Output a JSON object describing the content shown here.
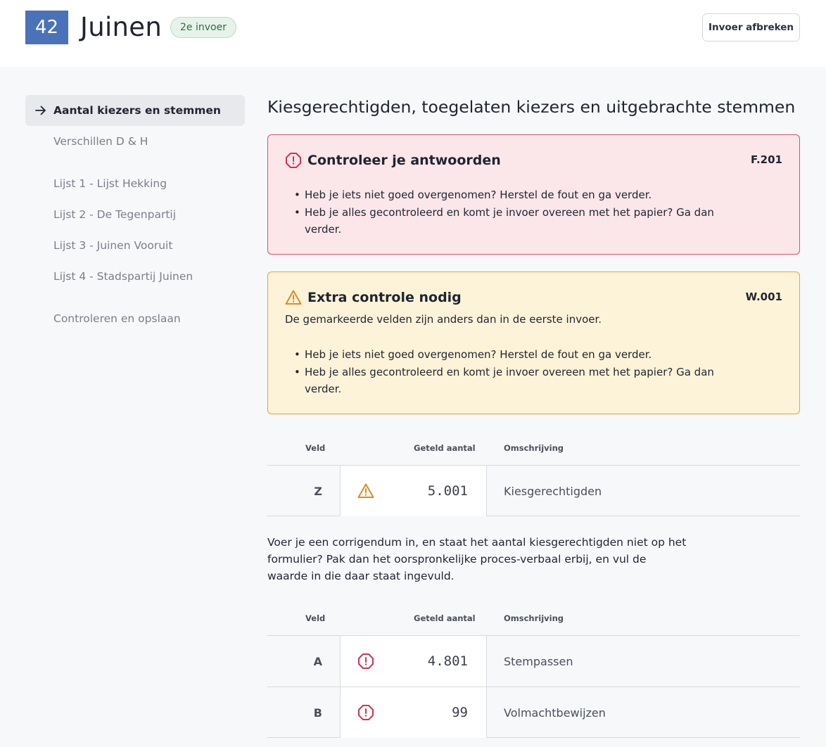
{
  "header": {
    "number": "42",
    "municipality": "Juinen",
    "entry_badge": "2e invoer",
    "abort_label": "Invoer afbreken"
  },
  "sidebar": {
    "items": [
      {
        "label": "Aantal kiezers en stemmen",
        "active": true
      },
      {
        "label": "Verschillen D & H"
      },
      {
        "label": "Lijst 1 - Lijst Hekking"
      },
      {
        "label": "Lijst 2 - De Tegenpartij"
      },
      {
        "label": "Lijst 3 - Juinen Vooruit"
      },
      {
        "label": "Lijst 4 - Stadspartij Juinen"
      },
      {
        "label": "Controleren en opslaan"
      }
    ]
  },
  "main": {
    "title": "Kiesgerechtigden, toegelaten kiezers en uitgebrachte stemmen",
    "error_alert": {
      "icon": "error-octagon-icon",
      "title": "Controleer je antwoorden",
      "code": "F.201",
      "items": [
        "Heb je iets niet goed overgenomen? Herstel de fout en ga verder.",
        "Heb je alles gecontroleerd en komt je invoer overeen met het papier? Ga dan verder."
      ]
    },
    "warning_alert": {
      "icon": "warning-triangle-icon",
      "title": "Extra controle nodig",
      "code": "W.001",
      "description": "De gemarkeerde velden zijn anders dan in de eerste invoer.",
      "items": [
        "Heb je iets niet goed overgenomen? Herstel de fout en ga verder.",
        "Heb je alles gecontroleerd en komt je invoer overeen met het papier? Ga dan verder."
      ]
    },
    "table1": {
      "headers": {
        "field": "Veld",
        "count": "Geteld aantal",
        "description": "Omschrijving"
      },
      "rows": [
        {
          "field": "Z",
          "value": "5.001",
          "description": "Kiesgerechtigden",
          "status": "warning"
        }
      ]
    },
    "note": "Voer je een corrigendum in, en staat het aantal kiesgerechtigden niet op het formulier? Pak dan het oorspronkelijke proces-verbaal erbij, en vul de waarde in die daar staat ingevuld.",
    "table2": {
      "headers": {
        "field": "Veld",
        "count": "Geteld aantal",
        "description": "Omschrijving"
      },
      "rows": [
        {
          "field": "A",
          "value": "4.801",
          "description": "Stempassen",
          "status": "error"
        },
        {
          "field": "B",
          "value": "99",
          "description": "Volmachtbewijzen",
          "status": "error"
        }
      ]
    }
  },
  "colors": {
    "brand_blue": "#4a72b8",
    "error": "#c8374e",
    "warning": "#e08a1e",
    "success_bg": "#e6f3ea"
  }
}
